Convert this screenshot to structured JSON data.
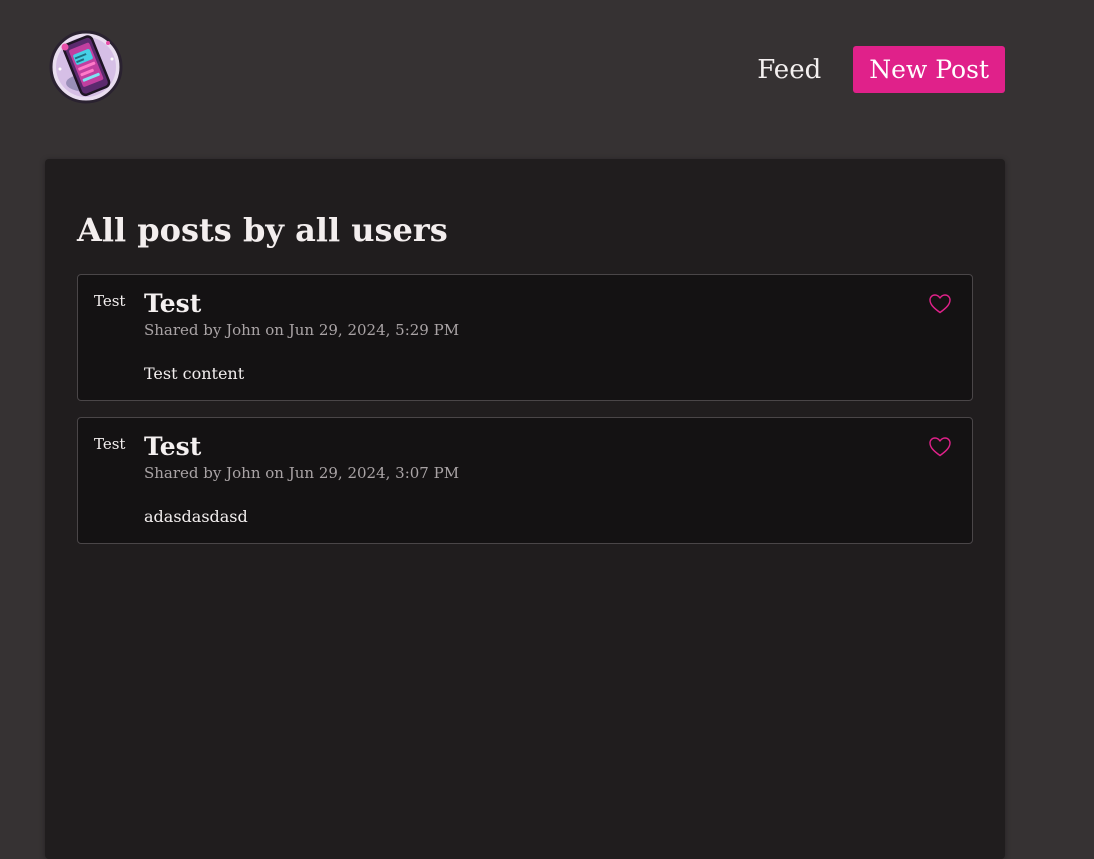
{
  "header": {
    "logo_alt": "App logo",
    "nav": {
      "feed_label": "Feed",
      "new_post_label": "New Post"
    }
  },
  "main": {
    "title": "All posts by all users",
    "posts": [
      {
        "tag": "Test",
        "title": "Test",
        "meta": "Shared by John on Jun 29, 2024, 5:29 PM",
        "content": "Test content",
        "like_icon": "heart-outline-icon"
      },
      {
        "tag": "Test",
        "title": "Test",
        "meta": "Shared by John on Jun 29, 2024, 3:07 PM",
        "content": "adasdasdasd",
        "like_icon": "heart-outline-icon"
      }
    ]
  },
  "colors": {
    "page_bg": "#363233",
    "panel_bg": "#201d1e",
    "card_bg": "#141213",
    "accent": "#e0218a"
  }
}
